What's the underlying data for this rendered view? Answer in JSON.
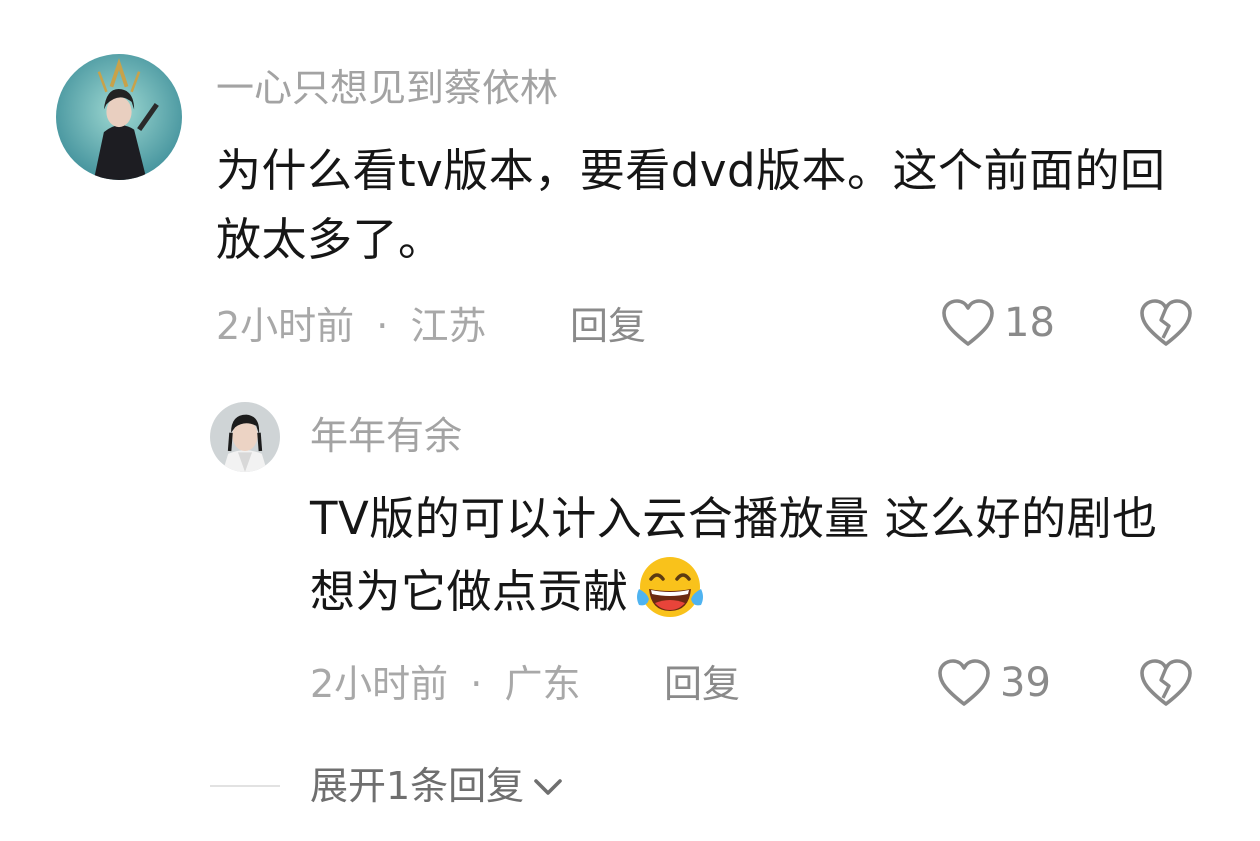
{
  "comment": {
    "username": "一心只想见到蔡依林",
    "text": "为什么看tv版本，要看dvd版本。这个前面的回放太多了。",
    "time": "2小时前",
    "location": "江苏",
    "reply_label": "回复",
    "likes": "18",
    "avatar_icon": "avatar-woman-costume",
    "like_icon": "heart-outline-icon",
    "dislike_icon": "broken-heart-icon"
  },
  "reply": {
    "username": "年年有余",
    "text": "TV版的可以计入云合播放量 这么好的剧也想为它做点贡献",
    "emoji": "joy-tears-emoji",
    "time": "2小时前",
    "location": "广东",
    "reply_label": "回复",
    "likes": "39",
    "avatar_icon": "avatar-man-costume",
    "like_icon": "heart-outline-icon",
    "dislike_icon": "broken-heart-icon"
  },
  "separator": "·",
  "expand": {
    "label": "展开1条回复",
    "icon": "chevron-down-icon"
  },
  "colors": {
    "text_primary": "#161616",
    "text_secondary": "#a3a3a3",
    "action": "#8a8a8a",
    "emoji_yellow": "#f9c21b",
    "emoji_tears": "#4fb3f0"
  }
}
